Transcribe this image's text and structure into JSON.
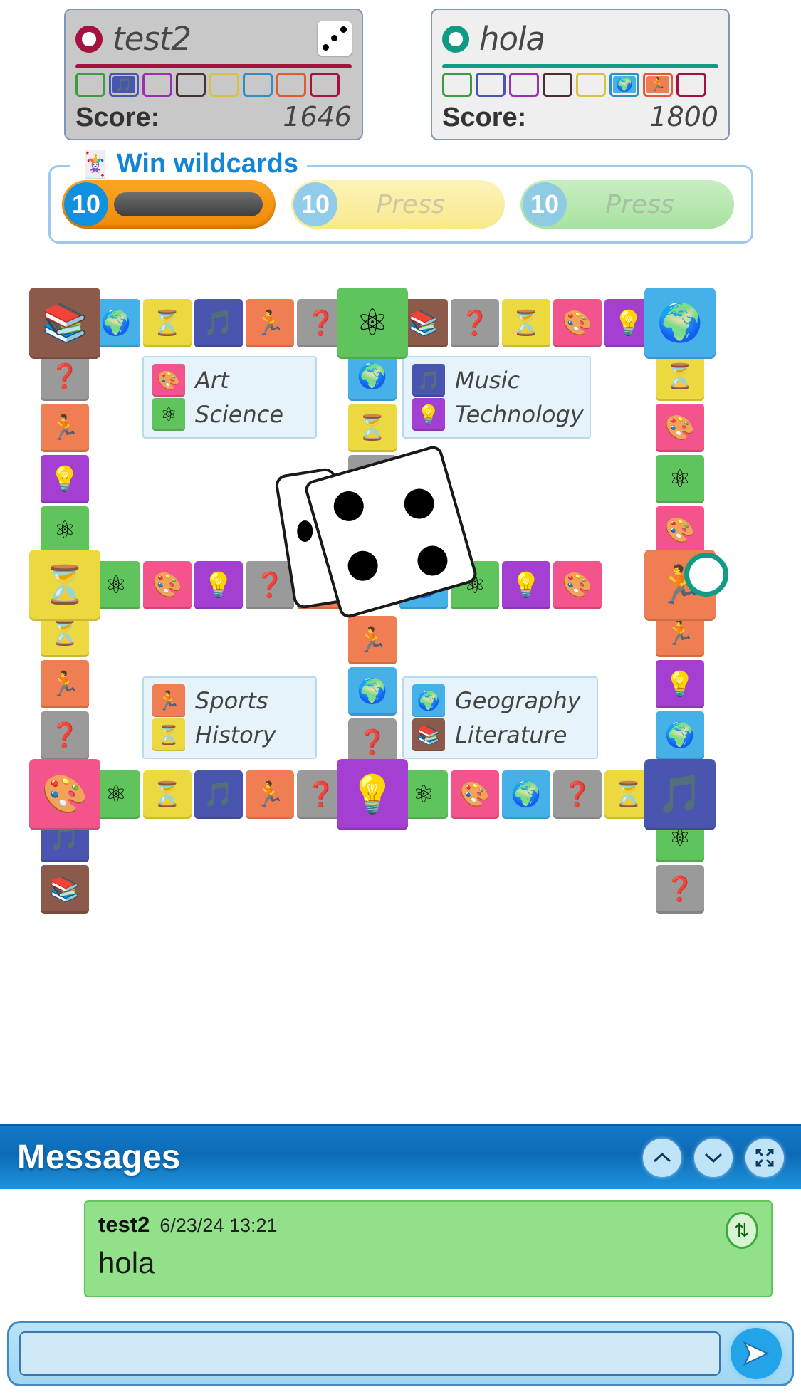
{
  "players": [
    {
      "name": "test2",
      "token_color": "#a5123f",
      "score_label": "Score:",
      "score": "1646",
      "dice_badge_icon": "dice-icon",
      "slots": [
        {
          "category": "",
          "icon": "",
          "border": "#3f9b42",
          "filled": false
        },
        {
          "category": "Music",
          "icon": "music-note-icon",
          "border": "#4a55b0",
          "filled": true
        },
        {
          "category": "",
          "icon": "",
          "border": "#9a2fb8",
          "filled": false
        },
        {
          "category": "",
          "icon": "",
          "border": "#4a3130",
          "filled": false
        },
        {
          "category": "",
          "icon": "",
          "border": "#d8c33c",
          "filled": false
        },
        {
          "category": "",
          "icon": "",
          "border": "#2f8ec4",
          "filled": false
        },
        {
          "category": "",
          "icon": "",
          "border": "#e25a33",
          "filled": false
        },
        {
          "category": "",
          "icon": "",
          "border": "#a5123f",
          "filled": false
        }
      ]
    },
    {
      "name": "hola",
      "token_color": "#109b85",
      "score_label": "Score:",
      "score": "1800",
      "dice_badge_icon": "",
      "slots": [
        {
          "category": "",
          "icon": "",
          "border": "#3f9b42",
          "filled": false
        },
        {
          "category": "",
          "icon": "",
          "border": "#4a55b0",
          "filled": false
        },
        {
          "category": "",
          "icon": "",
          "border": "#9a2fb8",
          "filled": false
        },
        {
          "category": "",
          "icon": "",
          "border": "#4a3130",
          "filled": false
        },
        {
          "category": "",
          "icon": "",
          "border": "#d8c33c",
          "filled": false
        },
        {
          "category": "Geography",
          "icon": "globe-icon",
          "border": "#2f8ec4",
          "filled": true
        },
        {
          "category": "Sports",
          "icon": "runner-icon",
          "border": "#e25a33",
          "filled": true
        },
        {
          "category": "",
          "icon": "",
          "border": "#a5123f",
          "filled": false
        }
      ]
    }
  ],
  "wildcards": {
    "title": "Win wildcards",
    "icon": "jester-hat-icon",
    "buttons": [
      {
        "count": "10",
        "label": "",
        "state": "active"
      },
      {
        "count": "10",
        "label": "Press",
        "state": "disabled-yellow"
      },
      {
        "count": "10",
        "label": "Press",
        "state": "disabled-green"
      }
    ]
  },
  "board": {
    "legend_groups": [
      {
        "rows": [
          {
            "name": "Art",
            "icon": "palette-icon",
            "color": "#f2548b"
          },
          {
            "name": "Science",
            "icon": "atom-icon",
            "color": "#5fc45c"
          }
        ]
      },
      {
        "rows": [
          {
            "name": "Music",
            "icon": "music-note-icon",
            "color": "#4a55b0"
          },
          {
            "name": "Technology",
            "icon": "lightbulb-gear-icon",
            "color": "#a33fd1"
          }
        ]
      },
      {
        "rows": [
          {
            "name": "Sports",
            "icon": "runner-icon",
            "color": "#ef7f52"
          },
          {
            "name": "History",
            "icon": "hourglass-icon",
            "color": "#ecd83f"
          }
        ]
      },
      {
        "rows": [
          {
            "name": "Geography",
            "icon": "globe-icon",
            "color": "#46b0e8"
          },
          {
            "name": "Literature",
            "icon": "books-icon",
            "color": "#8b5a4a"
          }
        ]
      }
    ],
    "top_row": [
      "literature",
      "geography",
      "history",
      "music",
      "sports",
      "wild",
      "science",
      "literature",
      "wild",
      "history",
      "art",
      "technology",
      "geography"
    ],
    "bottom_row": [
      "art",
      "science",
      "history",
      "music",
      "sports",
      "wild",
      "technology",
      "science",
      "art",
      "geography",
      "wild",
      "history",
      "music"
    ],
    "left_col": [
      "wild",
      "sports",
      "technology",
      "science",
      "geography",
      "history",
      "sports",
      "wild",
      "science",
      "music",
      "literature"
    ],
    "right_col": [
      "history",
      "art",
      "science",
      "art",
      "wild",
      "sports",
      "technology",
      "geography",
      "literature",
      "science",
      "wild"
    ],
    "center_col_top": [
      "geography",
      "history",
      "wild",
      "literature"
    ],
    "center_col_bottom": [
      "sports",
      "geography",
      "wild",
      "music"
    ],
    "middle_row_left": [
      "science",
      "art",
      "technology",
      "wild",
      "sports"
    ],
    "middle_row_right": [
      "geography",
      "science",
      "technology",
      "art"
    ],
    "dice_value": "4",
    "pawns": [
      {
        "player": "hola",
        "color": "#109b85",
        "position": "right-middle"
      }
    ]
  },
  "messages": {
    "title": "Messages",
    "controls": [
      {
        "name": "scroll-up-button",
        "glyph": "⌃"
      },
      {
        "name": "scroll-down-button",
        "glyph": "⌄"
      },
      {
        "name": "expand-button",
        "glyph": "⛶"
      }
    ],
    "items": [
      {
        "user": "test2",
        "time": "6/23/24 13:21",
        "text": "hola",
        "sort_icon": "sort-updown-icon"
      }
    ]
  },
  "composer": {
    "input_value": "",
    "input_placeholder": "",
    "send_icon": "send-arrow-icon"
  }
}
